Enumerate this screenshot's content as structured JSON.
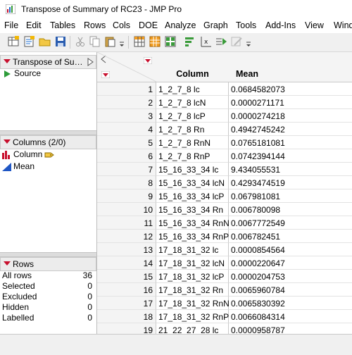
{
  "window": {
    "title": "Transpose of Summary of RC23 - JMP Pro"
  },
  "menu": [
    "File",
    "Edit",
    "Tables",
    "Rows",
    "Cols",
    "DOE",
    "Analyze",
    "Graph",
    "Tools",
    "Add-Ins",
    "View",
    "Wind"
  ],
  "toolbar": {
    "icons": [
      "new-data-table-icon",
      "new-script-icon",
      "open-icon",
      "save-icon",
      "cut-icon",
      "copy-icon",
      "paste-icon",
      "customize-icon",
      "data-table-icon",
      "grid-icon",
      "layout-icon",
      "distribution-icon",
      "fit-y-by-x-icon",
      "run-script-icon",
      "annotate-icon"
    ]
  },
  "table_panel": {
    "title": "Transpose of Su…",
    "items": [
      "Source"
    ]
  },
  "columns_panel": {
    "title": "Columns (2/0)",
    "items": [
      "Column",
      "Mean"
    ]
  },
  "rows_panel": {
    "title": "Rows",
    "items": [
      {
        "label": "All rows",
        "value": "36"
      },
      {
        "label": "Selected",
        "value": "0"
      },
      {
        "label": "Excluded",
        "value": "0"
      },
      {
        "label": "Hidden",
        "value": "0"
      },
      {
        "label": "Labelled",
        "value": "0"
      }
    ]
  },
  "grid": {
    "headers": [
      "Column",
      "Mean"
    ],
    "rows": [
      [
        "1",
        "1_2_7_8 lc",
        "0.0684582073"
      ],
      [
        "2",
        "1_2_7_8 lcN",
        "0.0000271171"
      ],
      [
        "3",
        "1_2_7_8 lcP",
        "0.0000274218"
      ],
      [
        "4",
        "1_2_7_8 Rn",
        "0.4942745242"
      ],
      [
        "5",
        "1_2_7_8 RnN",
        "0.0765181081"
      ],
      [
        "6",
        "1_2_7_8 RnP",
        "0.0742394144"
      ],
      [
        "7",
        "15_16_33_34 lc",
        "9.434055531"
      ],
      [
        "8",
        "15_16_33_34 lcN",
        "0.4293474519"
      ],
      [
        "9",
        "15_16_33_34 lcP",
        "0.067981081"
      ],
      [
        "10",
        "15_16_33_34 Rn",
        "0.006780098"
      ],
      [
        "11",
        "15_16_33_34 RnN",
        "0.0067772549"
      ],
      [
        "12",
        "15_16_33_34 RnP",
        "0.006782451"
      ],
      [
        "13",
        "17_18_31_32 lc",
        "0.0000854564"
      ],
      [
        "14",
        "17_18_31_32 lcN",
        "0.0000220647"
      ],
      [
        "15",
        "17_18_31_32 lcP",
        "0.0000204753"
      ],
      [
        "16",
        "17_18_31_32 Rn",
        "0.0065960784"
      ],
      [
        "17",
        "17_18_31_32 RnN",
        "0.0065830392"
      ],
      [
        "18",
        "17_18_31_32 RnP",
        "0.0066084314"
      ],
      [
        "19",
        "21_22_27_28 lc",
        "0.0000958787"
      ]
    ]
  }
}
